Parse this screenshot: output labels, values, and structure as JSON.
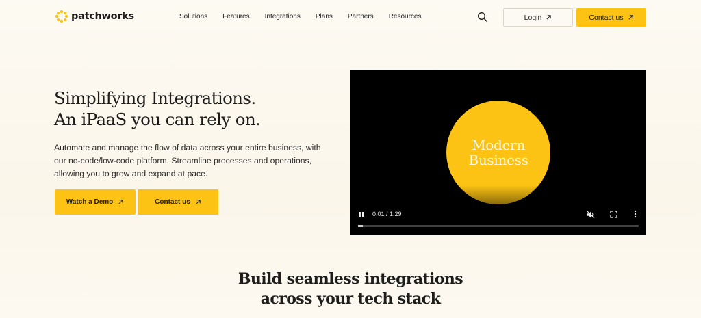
{
  "header": {
    "logo_text": "patchworks",
    "nav": [
      "Solutions",
      "Features",
      "Integrations",
      "Plans",
      "Partners",
      "Resources"
    ],
    "login_label": "Login",
    "contact_label": "Contact us"
  },
  "hero": {
    "title_line1": "Simplifying Integrations.",
    "title_line2": "An iPaaS you can rely on.",
    "description": "Automate and manage the flow of data across your entire business, with our no-code/low-code platform. Streamline processes and operations, allowing you to grow and expand at pace.",
    "watch_demo_label": "Watch a Demo",
    "contact_label": "Contact us"
  },
  "video": {
    "circle_line1": "Modern",
    "circle_line2": "Business",
    "time": "0:01 / 1:29",
    "progress_fraction": 0.017
  },
  "section": {
    "title_line1": "Build seamless integrations",
    "title_line2": "across your tech stack"
  },
  "colors": {
    "accent": "#fcc314",
    "background": "#fdfaf3",
    "text": "#1d1d1b"
  }
}
